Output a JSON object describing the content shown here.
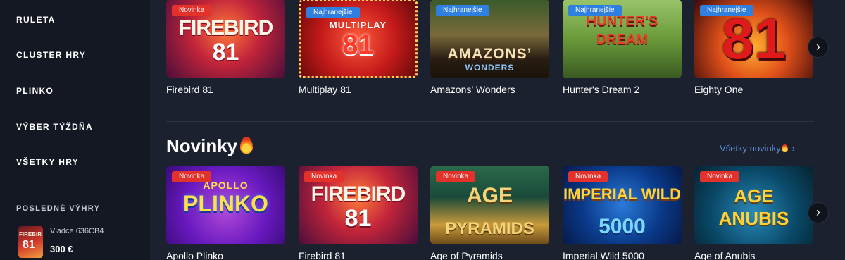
{
  "sidebar": {
    "items": [
      {
        "label": "RULETA"
      },
      {
        "label": "CLUSTER HRY"
      },
      {
        "label": "PLINKO"
      },
      {
        "label": "VÝBER TÝŽDŇA"
      },
      {
        "label": "VŠETKY HRY"
      }
    ],
    "recent_wins": {
      "title": "POSLEDNÉ VÝHRY",
      "user": "Vladce 636CB4",
      "amount": "300 €",
      "thumb_text_top": "FIREBIR",
      "thumb_text_bottom": "81"
    }
  },
  "row1": {
    "games": [
      {
        "badge": "Novinka",
        "badge_type": "new",
        "name": "Firebird 81",
        "art_top": "FIREBIRD",
        "art_bottom": "81"
      },
      {
        "badge": "Najhranejšie",
        "badge_type": "hot",
        "name": "Multiplay 81",
        "art_top": "MULTIPLAY",
        "art_bottom": "81"
      },
      {
        "badge": "Najhranejšie",
        "badge_type": "hot",
        "name": "Amazons’ Wonders",
        "art_top": "AMAZONS’",
        "art_bottom": "WONDERS"
      },
      {
        "badge": "Najhranejšie",
        "badge_type": "hot",
        "name": "Hunter's Dream 2",
        "art_top": "HUNTER'S",
        "art_bottom": "DREAM"
      },
      {
        "badge": "Najhranejšie",
        "badge_type": "hot",
        "name": "Eighty One",
        "art_top": "81",
        "art_bottom": ""
      }
    ]
  },
  "section": {
    "title": "Novinky",
    "all_link": "Všetky novinky",
    "chevron": "›"
  },
  "row2": {
    "games": [
      {
        "badge": "Novinka",
        "badge_type": "new",
        "name": "Apollo Plinko",
        "art_top": "APOLLO",
        "art_bottom": "PLINKO"
      },
      {
        "badge": "Novinka",
        "badge_type": "new",
        "name": "Firebird 81",
        "art_top": "FIREBIRD",
        "art_bottom": "81"
      },
      {
        "badge": "Novinka",
        "badge_type": "new",
        "name": "Age of Pyramids",
        "art_top": "AGE",
        "art_bottom": "PYRAMIDS"
      },
      {
        "badge": "Novinka",
        "badge_type": "new",
        "name": "Imperial Wild 5000",
        "art_top": "IMPERIAL WILD",
        "art_bottom": "5000"
      },
      {
        "badge": "Novinka",
        "badge_type": "new",
        "name": "Age of Anubis",
        "art_top": "AGE",
        "art_bottom": "ANUBIS"
      }
    ]
  },
  "carousel": {
    "next_label": "›"
  },
  "colors": {
    "background": "#1c2130",
    "sidebar": "#141822",
    "badge_new": "#e3312b",
    "badge_hot": "#2f7fe0",
    "link": "#5a8fd8"
  }
}
